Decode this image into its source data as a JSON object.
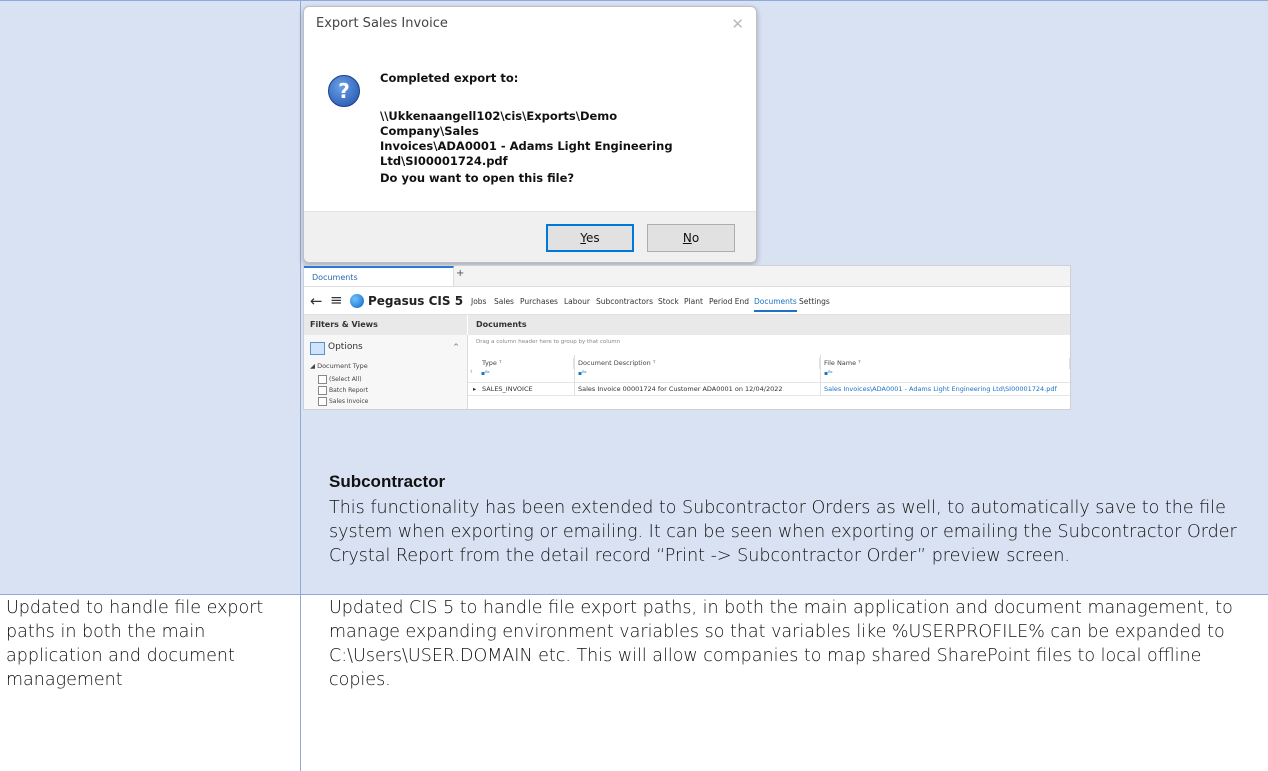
{
  "dialog": {
    "title": "Export Sales Invoice",
    "close_glyph": "✕",
    "icon_glyph": "?",
    "line1": "Completed export to:",
    "path_lines": [
      "\\\\Ukkenaangell102\\cis\\Exports\\Demo Company\\Sales",
      "Invoices\\ADA0001 - Adams Light Engineering",
      "Ltd\\SI00001724.pdf"
    ],
    "question": "Do you want to open this file?",
    "yes_label_u": "Y",
    "yes_label_rest": "es",
    "no_label_u": "N",
    "no_label_rest": "o"
  },
  "app": {
    "tab_label": "Documents",
    "plus_tab": "+",
    "back_glyph": "←",
    "menu_glyph": "≡",
    "brand": "Pegasus CIS 5",
    "nav": [
      "Jobs",
      "Sales",
      "Purchases",
      "Labour",
      "Subcontractors",
      "Stock",
      "Plant",
      "Period End",
      "Documents",
      "Settings"
    ],
    "active_nav": "Documents",
    "filters_title": "Filters & Views",
    "docs_title": "Documents",
    "options_label": "Options",
    "options_caret": "^",
    "document_type_label": "◢ Document Type",
    "checks": [
      "(Select All)",
      "Batch Report",
      "Sales Invoice"
    ],
    "group_hint": "Drag a column header here to group by that column",
    "columns": [
      "Type ᵀ",
      "Document Description ᵀ",
      "File Name ᵀ"
    ],
    "filter_glyphs": [
      "ᵀ",
      "▪ᴮᶜ",
      "▪ᴮᶜ",
      "▪ᴮᶜ"
    ],
    "row": {
      "marker": "▸",
      "type": "SALES_INVOICE",
      "description": "Sales Invoice 00001724 for Customer ADA0001 on 12/04/2022",
      "file_name": "Sales Invoices\\ADA0001 - Adams Light Engineering Ltd\\SI00001724.pdf"
    }
  },
  "section": {
    "heading": "Subcontractor",
    "paragraph": "This functionality has been extended to Subcontractor Orders as well, to automatically save to the file system when exporting or emailing.  It can be seen when exporting or emailing the Subcontractor Order Crystal Report from the detail record “Print -> Subcontractor Order” preview screen."
  },
  "row2": {
    "left": "Updated to handle file export paths in both the main application and document management",
    "right": "Updated CIS 5 to handle file export paths, in both the main application and document management, to manage expanding environment variables so that variables like %USERPROFILE% can be expanded to C:\\Users\\USER.DOMAIN etc. This will allow companies to map shared SharePoint files to local offline copies."
  },
  "colors": {
    "table_fill": "#d9e2f3",
    "table_border": "#8eaadb",
    "accent": "#1a73c7"
  }
}
